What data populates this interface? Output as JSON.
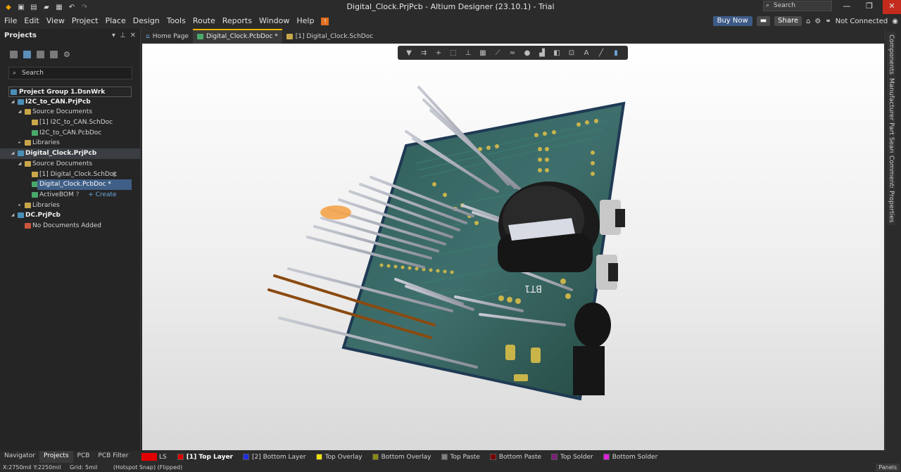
{
  "window": {
    "title": "Digital_Clock.PrjPcb - Altium Designer (23.10.1) - Trial",
    "search_placeholder": "Search",
    "minimize": "—",
    "maximize": "❐",
    "close": "✕"
  },
  "menu": [
    "File",
    "Edit",
    "View",
    "Project",
    "Place",
    "Design",
    "Tools",
    "Route",
    "Reports",
    "Window",
    "Help"
  ],
  "header_right": {
    "buy_now": "Buy Now",
    "share": "Share",
    "connection": "Not Connected"
  },
  "projects_panel": {
    "title": "Projects",
    "search_placeholder": "Search",
    "tree": [
      {
        "label": "Project Group 1.DsnWrk",
        "level": 0,
        "icon": "workspace-icon",
        "bold": true
      },
      {
        "label": "I2C_to_CAN.PrjPcb",
        "level": 0,
        "icon": "project-icon",
        "bold": true
      },
      {
        "label": "Source Documents",
        "level": 1,
        "icon": "folder-icon"
      },
      {
        "label": "[1] I2C_to_CAN.SchDoc",
        "level": 2,
        "icon": "schematic-icon"
      },
      {
        "label": "I2C_to_CAN.PcbDoc",
        "level": 2,
        "icon": "pcb-icon"
      },
      {
        "label": "Libraries",
        "level": 1,
        "icon": "folder-icon"
      },
      {
        "label": "Digital_Clock.PrjPcb",
        "level": 0,
        "icon": "project-icon",
        "bold": true
      },
      {
        "label": "Source Documents",
        "level": 1,
        "icon": "folder-icon"
      },
      {
        "label": "[1] Digital_Clock.SchDoc",
        "level": 2,
        "icon": "schematic-icon"
      },
      {
        "label": "Digital_Clock.PcbDoc *",
        "level": 2,
        "icon": "pcb-icon"
      },
      {
        "label": "ActiveBOM",
        "level": 2,
        "icon": "bom-icon"
      },
      {
        "label": "Libraries",
        "level": 1,
        "icon": "folder-icon"
      },
      {
        "label": "DC.PrjPcb",
        "level": 0,
        "icon": "project-icon",
        "bold": true
      },
      {
        "label": "No Documents Added",
        "level": 1,
        "icon": "empty-folder-icon"
      }
    ],
    "create_link": "+ Create"
  },
  "bottom_panel_tabs": [
    "Navigator",
    "Projects",
    "PCB",
    "PCB Filter"
  ],
  "document_tabs": [
    {
      "label": "Home Page",
      "active": false
    },
    {
      "label": "Digital_Clock.PcbDoc *",
      "active": true
    },
    {
      "label": "[1] Digital_Clock.SchDoc",
      "active": false
    }
  ],
  "right_rail": [
    "Components",
    "Manufacturer Part Search",
    "Comments",
    "Properties"
  ],
  "layers": {
    "ls_label": "LS",
    "items": [
      {
        "label": "[1] Top Layer",
        "color": "#e00000",
        "active": true
      },
      {
        "label": "[2] Bottom Layer",
        "color": "#1f2ee0"
      },
      {
        "label": "Top Overlay",
        "color": "#f0e000"
      },
      {
        "label": "Bottom Overlay",
        "color": "#8a8a10"
      },
      {
        "label": "Top Paste",
        "color": "#808080"
      },
      {
        "label": "Bottom Paste",
        "color": "#7a0000"
      },
      {
        "label": "Top Solder",
        "color": "#7a1f7a"
      },
      {
        "label": "Bottom Solder",
        "color": "#e020e0"
      }
    ]
  },
  "status": {
    "coords": "X:2750mil Y:2250mil",
    "grid": "Grid: 5mil",
    "snap": "(Hotspot Snap) (Flipped)",
    "panels": "Panels"
  },
  "board_silk": "BT1"
}
